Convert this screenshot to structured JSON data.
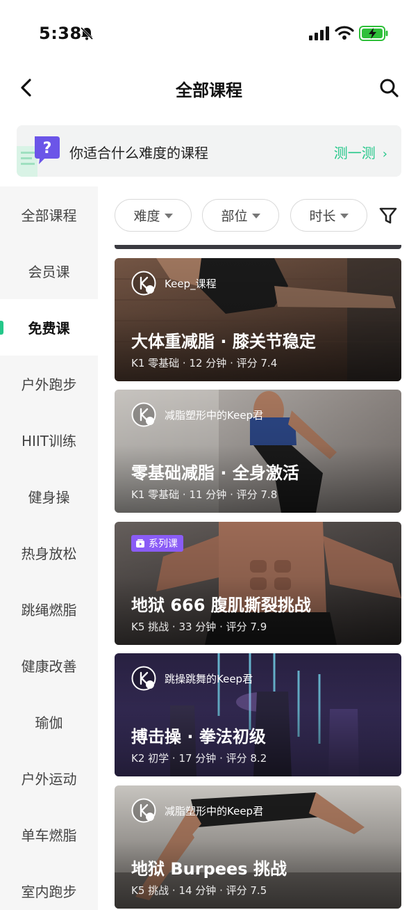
{
  "status_bar": {
    "time": "5:38",
    "icons": [
      "bell-muted-icon",
      "cellular-signal-icon",
      "wifi-icon",
      "battery-charging-icon"
    ],
    "battery_color": "#2fbf3a"
  },
  "nav": {
    "title": "全部课程",
    "back_icon": "chevron-left-icon",
    "search_icon": "search-icon"
  },
  "quiz_banner": {
    "text": "你适合什么难度的课程",
    "action": "测一测",
    "action_icon": "chevron-right-icon"
  },
  "accent_color": "#24c789",
  "sidebar": {
    "items": [
      {
        "label": "全部课程",
        "active": false
      },
      {
        "label": "会员课",
        "active": false
      },
      {
        "label": "免费课",
        "active": true
      },
      {
        "label": "户外跑步",
        "active": false
      },
      {
        "label": "HIIT训练",
        "active": false
      },
      {
        "label": "健身操",
        "active": false
      },
      {
        "label": "热身放松",
        "active": false
      },
      {
        "label": "跳绳燃脂",
        "active": false
      },
      {
        "label": "健康改善",
        "active": false
      },
      {
        "label": "瑜伽",
        "active": false
      },
      {
        "label": "户外运动",
        "active": false
      },
      {
        "label": "单车燃脂",
        "active": false
      },
      {
        "label": "室内跑步",
        "active": false
      }
    ]
  },
  "filters": {
    "chips": [
      {
        "label": "难度"
      },
      {
        "label": "部位"
      },
      {
        "label": "时长"
      }
    ],
    "filter_icon": "funnel-icon"
  },
  "courses": [
    {
      "author": "Keep_课程",
      "title": "大体重减脂 · 膝关节稳定",
      "meta": "K1 零基础 · 12 分钟 · 评分 7.4"
    },
    {
      "author": "减脂塑形中的Keep君",
      "title": "零基础减脂 · 全身激活",
      "meta": "K1 零基础 · 11 分钟 · 评分 7.8"
    },
    {
      "tag": "系列课",
      "title": "地狱 666 腹肌撕裂挑战",
      "meta": "K5 挑战 · 33 分钟 · 评分 7.9"
    },
    {
      "author": "跳操跳舞的Keep君",
      "title": "搏击操 · 拳法初级",
      "meta": "K2 初学 · 17 分钟 · 评分 8.2"
    },
    {
      "author": "减脂塑形中的Keep君",
      "title": "地狱 Burpees 挑战",
      "meta": "K5 挑战 · 14 分钟 · 评分 7.5"
    }
  ]
}
